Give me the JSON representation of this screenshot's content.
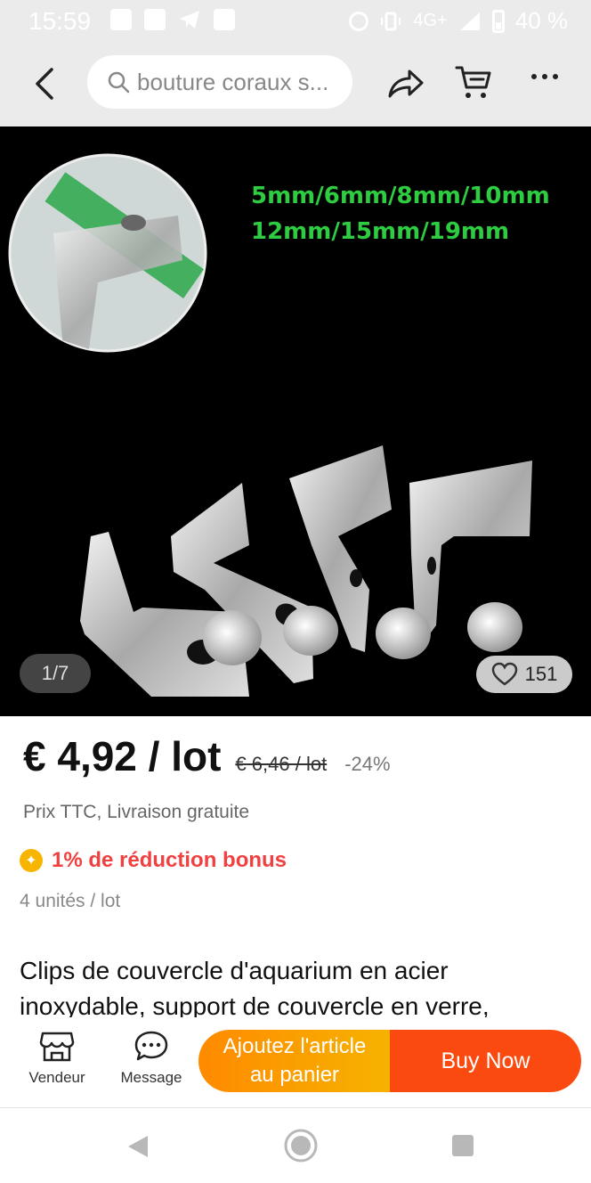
{
  "status_bar": {
    "time": "15:59",
    "network": "4G+",
    "battery": "40 %"
  },
  "header": {
    "search": {
      "text": "bouture coraux s..."
    },
    "icons": [
      "back-arrow-icon",
      "search-icon",
      "share-icon",
      "cart-icon",
      "more-icon"
    ]
  },
  "gallery": {
    "sizes_line1": "5mm/6mm/8mm/10mm",
    "sizes_line2": "12mm/15mm/19mm",
    "counter": "1/7",
    "likes": "151"
  },
  "product": {
    "price": "€ 4,92 / lot",
    "old_price": "€ 6,46 / lot",
    "discount": "-24%",
    "price_note": "Prix TTC, Livraison gratuite",
    "bonus": "1% de réduction bonus",
    "units": "4 unités / lot",
    "title": "Clips de couvercle d'aquarium en acier inoxydable, support de couvercle en verre,"
  },
  "actions": {
    "seller": "Vendeur",
    "message": "Message",
    "add_to_cart_line1": "Ajoutez l'article",
    "add_to_cart_line2": "au panier",
    "buy_now": "Buy Now"
  },
  "colors": {
    "accent_red": "#fb4a10",
    "accent_orange": "#ff8a00",
    "bonus_text": "#f04040",
    "sizes_green": "#2ecc40"
  }
}
